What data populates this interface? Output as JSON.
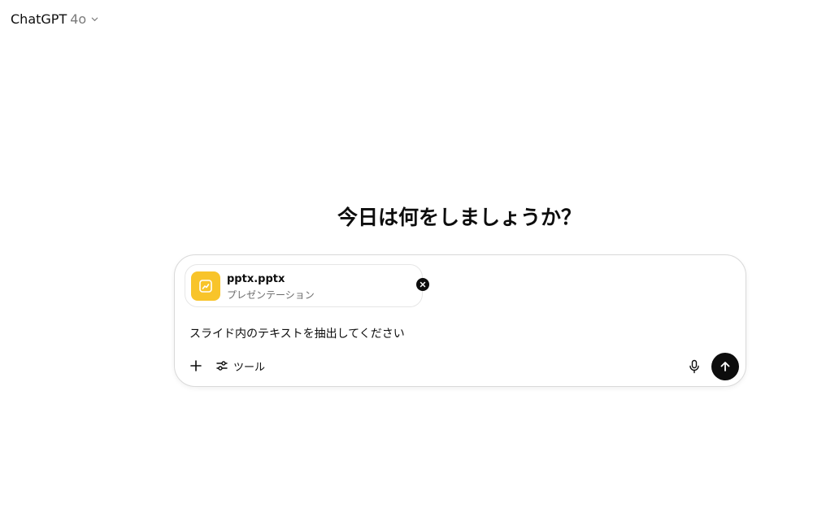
{
  "header": {
    "model_name": "ChatGPT",
    "model_version": "4o"
  },
  "main": {
    "greeting": "今日は何をしましょうか？"
  },
  "composer": {
    "attachment": {
      "file_name": "pptx.pptx",
      "file_type": "プレゼンテーション",
      "icon": "presentation-chart-icon",
      "icon_bg_color": "#f8c42a"
    },
    "prompt": "スライド内のテキストを抽出してください",
    "tools_label": "ツール",
    "icons": {
      "plus": "plus-icon",
      "tools": "sliders-icon",
      "mic": "microphone-icon",
      "send": "arrow-up-icon",
      "remove": "close-circle-icon"
    }
  }
}
